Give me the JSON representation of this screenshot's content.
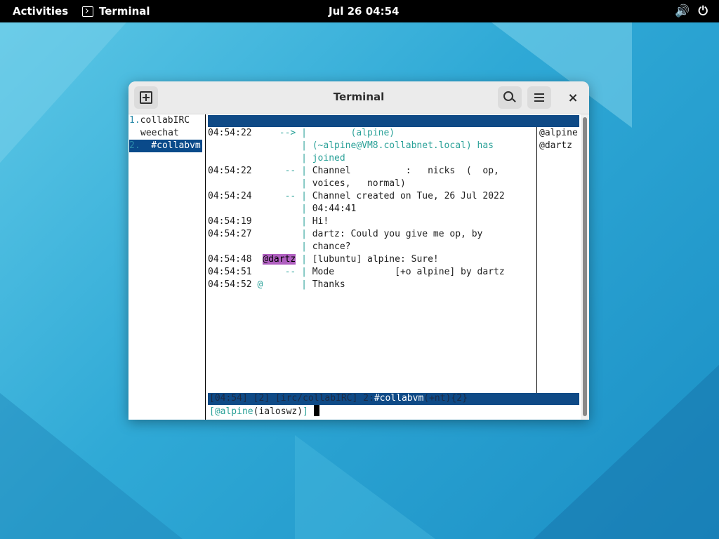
{
  "topbar": {
    "activities": "Activities",
    "app_name": "Terminal",
    "app_icon": "terminal-icon",
    "clock": "Jul 26  04:54",
    "volume_icon": "volume-icon",
    "power_icon": "power-icon"
  },
  "window": {
    "title": "Terminal",
    "new_tab_icon": "new-tab-icon",
    "search_icon": "search-icon",
    "menu_icon": "hamburger-menu-icon",
    "close_label": "×"
  },
  "buflist": {
    "items": [
      {
        "num": "1.",
        "label": "collabIRC"
      },
      {
        "num": "",
        "label": "weechat"
      },
      {
        "num": "2.",
        "label": "  #collabvm"
      }
    ]
  },
  "chat": {
    "lines": [
      {
        "time": "04:54:22",
        "prefix": "-->",
        "text": "       (alpine)"
      },
      {
        "time": "",
        "prefix": "",
        "text": "(~alpine@VM8.collabnet.local) has"
      },
      {
        "time": "",
        "prefix": "",
        "text": "joined"
      },
      {
        "time": "04:54:22",
        "prefix": "--",
        "text": "Channel          :   nicks  (  op,"
      },
      {
        "time": "",
        "prefix": "",
        "text": "voices,   normal)"
      },
      {
        "time": "04:54:24",
        "prefix": "--",
        "text": "Channel created on Tue, 26 Jul 2022"
      },
      {
        "time": "",
        "prefix": "",
        "text": "04:44:41"
      },
      {
        "time": "04:54:19",
        "prefix": "",
        "text": "Hi!"
      },
      {
        "time": "04:54:27",
        "prefix": "",
        "text": "dartz: Could you give me op, by"
      },
      {
        "time": "",
        "prefix": "",
        "text": "chance?"
      },
      {
        "time": "04:54:48",
        "prefix": "@dartz",
        "text": "[lubuntu] alpine: Sure!"
      },
      {
        "time": "04:54:51",
        "prefix": "--",
        "text": "Mode           [+o alpine] by dartz"
      },
      {
        "time": "04:54:52",
        "prefix": "@",
        "text": "Thanks"
      }
    ]
  },
  "nicklist": {
    "nicks": [
      "@alpine",
      "@dartz"
    ]
  },
  "statusbar": {
    "time": "[04:54]",
    "count": "[2]",
    "server": "[irc/collabIRC]",
    "buffer_num": "2:",
    "buffer_name": "#collabvm",
    "modes": "(+nt)",
    "extra": "{2}"
  },
  "input": {
    "prompt_open": "[",
    "nick": "@alpine",
    "mode": "(ialoswz)",
    "prompt_close": "]"
  }
}
